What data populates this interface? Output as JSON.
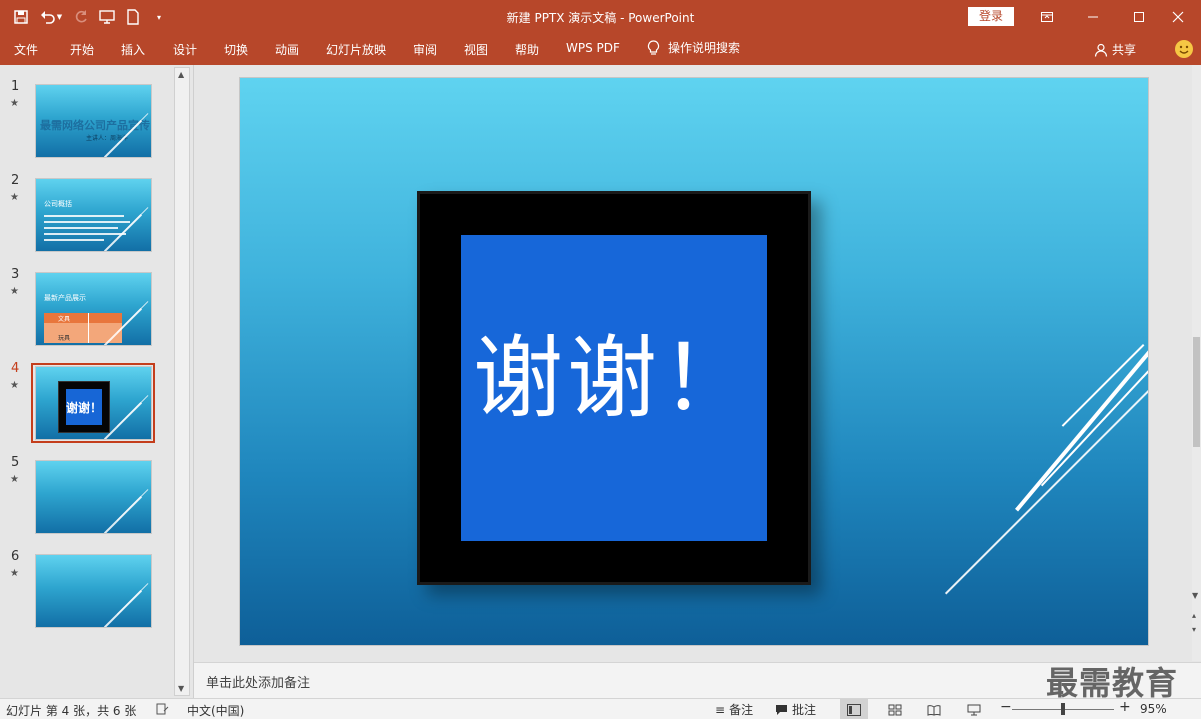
{
  "window": {
    "title": "新建 PPTX 演示文稿 - PowerPoint",
    "login_label": "登录"
  },
  "ribbon": {
    "tabs": [
      "文件",
      "开始",
      "插入",
      "设计",
      "切换",
      "动画",
      "幻灯片放映",
      "审阅",
      "视图",
      "帮助",
      "WPS PDF"
    ],
    "tell_me": "操作说明搜索",
    "share": "共享"
  },
  "thumbnails": {
    "items": [
      {
        "number": "1",
        "star": "★",
        "title": "最需网络公司产品宣传",
        "subtitle": "主讲人：周海洋"
      },
      {
        "number": "2",
        "star": "★",
        "heading": "公司概括"
      },
      {
        "number": "3",
        "star": "★",
        "heading": "最新产品展示",
        "table_cell_1": "文具",
        "table_cell_2": "玩具"
      },
      {
        "number": "4",
        "star": "★",
        "thanks": "谢谢！"
      },
      {
        "number": "5",
        "star": "★"
      },
      {
        "number": "6",
        "star": "★"
      }
    ],
    "selected_index": 4
  },
  "slide": {
    "text": "谢谢！"
  },
  "notes": {
    "placeholder": "单击此处添加备注"
  },
  "statusbar": {
    "slide_info": "幻灯片 第 4 张，共 6 张",
    "language": "中文(中国)",
    "notes_label": "备注",
    "comments_label": "批注",
    "zoom": "95%",
    "zoom_fraction": 0.5
  },
  "watermark": "最需教育",
  "colors": {
    "accent": "#b7472a",
    "selection": "#c43e1c",
    "slide_blue": "#1767d9"
  }
}
